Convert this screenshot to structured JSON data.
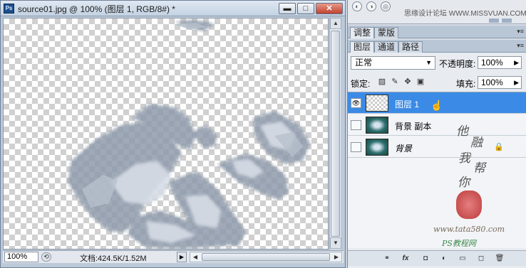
{
  "document": {
    "title": "source01.jpg @ 100% (图层 1, RGB/8#) *",
    "window_buttons": [
      "minimize",
      "restore",
      "close"
    ],
    "zoom": "100%",
    "doc_info": "文档:424.5K/1.52M"
  },
  "top_panel": {
    "watermark": "思缘设计论坛 WWW.MISSVUAN.COM"
  },
  "tabs_top": [
    {
      "label": "调整",
      "active": true
    },
    {
      "label": "蒙版",
      "active": false
    }
  ],
  "tabs_layers": [
    {
      "label": "图层",
      "active": true
    },
    {
      "label": "通道",
      "active": false
    },
    {
      "label": "路径",
      "active": false
    }
  ],
  "layers_panel": {
    "blend_mode": "正常",
    "opacity_label": "不透明度:",
    "opacity_value": "100%",
    "lock_label": "锁定:",
    "fill_label": "填充:",
    "fill_value": "100%",
    "layers": [
      {
        "name": "图层 1",
        "selected": true,
        "visible": true,
        "locked": false
      },
      {
        "name": "背景 副本",
        "selected": false,
        "visible": false,
        "locked": false
      },
      {
        "name": "背景",
        "selected": false,
        "visible": false,
        "locked": true
      }
    ]
  },
  "overlay": {
    "handwriting": [
      "他",
      "融",
      "我",
      "帮",
      "你"
    ],
    "url": "www.tata580.com",
    "site": "PS教程网"
  },
  "colors": {
    "selection_blue": "#3b8be6",
    "panel_bg": "#e8ecf1",
    "titlebar": "#c4d2e2"
  }
}
